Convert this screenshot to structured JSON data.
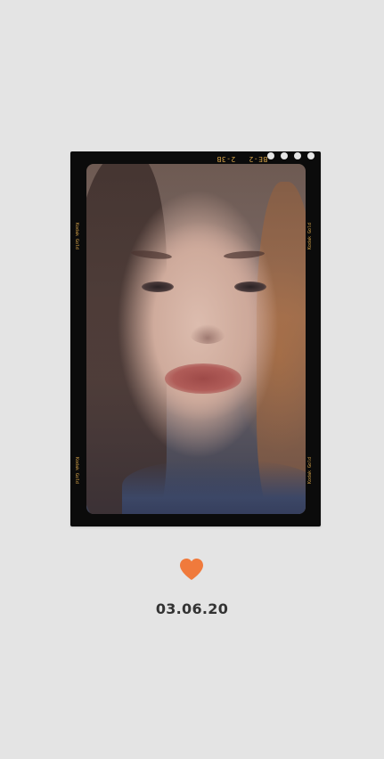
{
  "film_frame": {
    "edge_codes": [
      "2-3B",
      "BE-2"
    ],
    "side_label": "Kodak Gold"
  },
  "photo": {
    "subject": "selfie portrait"
  },
  "heart_color": "#f07a3c",
  "date": "03.06.20"
}
